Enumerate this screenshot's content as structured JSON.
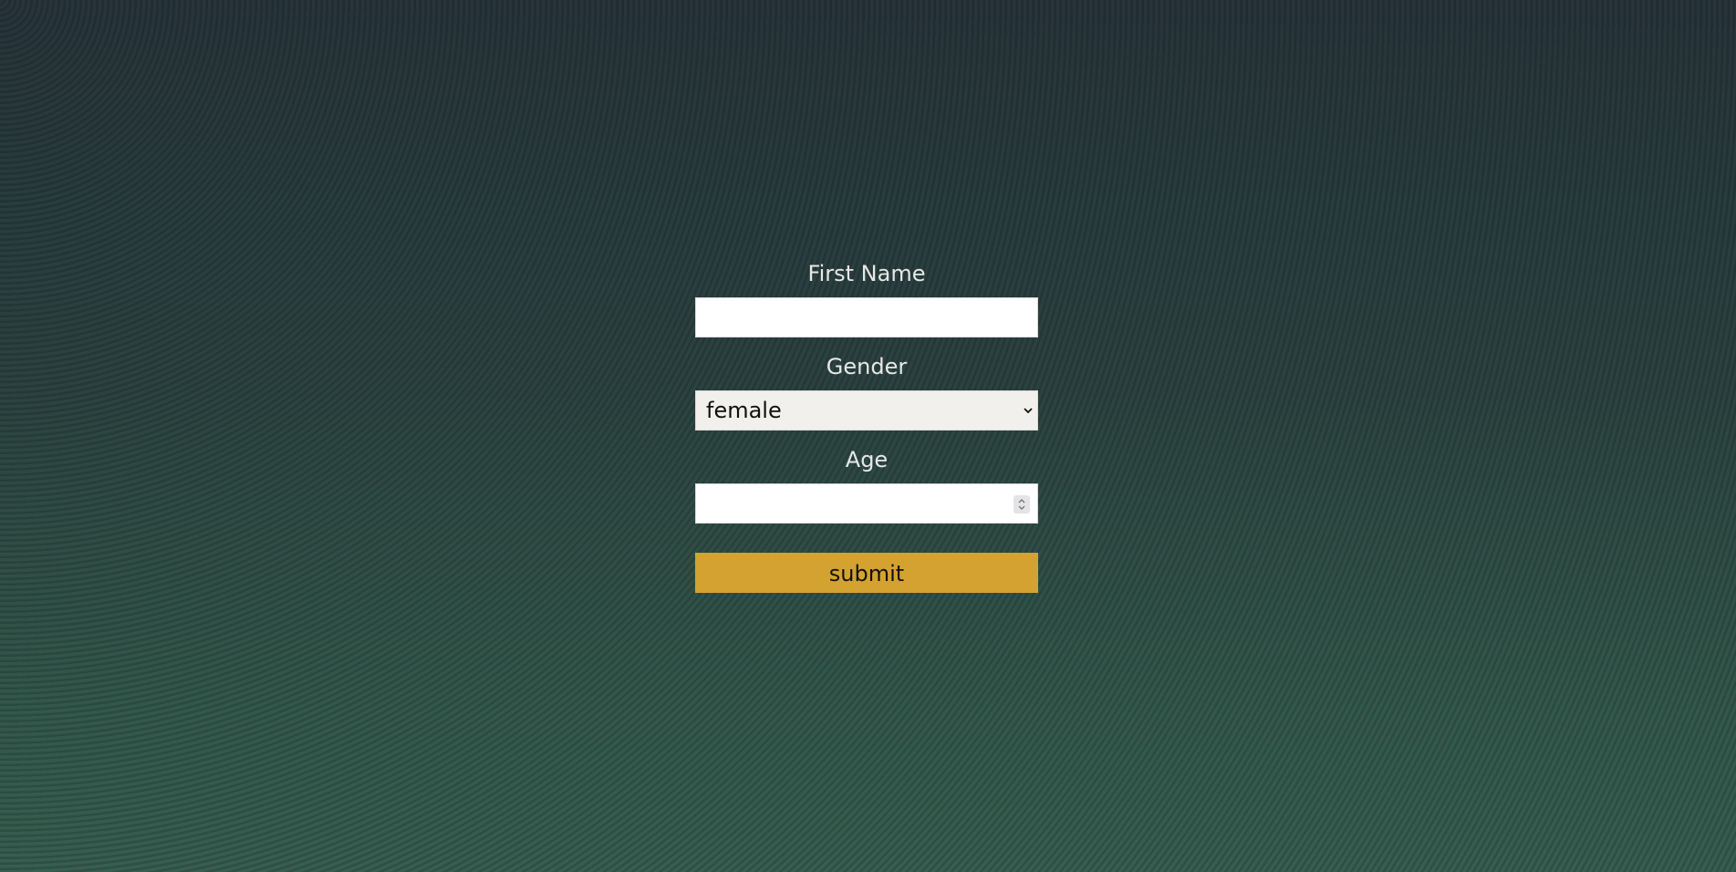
{
  "form": {
    "first_name": {
      "label": "First Name",
      "value": ""
    },
    "gender": {
      "label": "Gender",
      "selected": "female"
    },
    "age": {
      "label": "Age",
      "value": ""
    },
    "submit_label": "submit"
  },
  "colors": {
    "background_top": "#27343b",
    "background_bottom": "#375e50",
    "button": "#d4a231",
    "label_text": "#e6e8e6"
  },
  "icons": {
    "select": "chevron-down-icon",
    "stepper": "spin-stepper-icon"
  }
}
